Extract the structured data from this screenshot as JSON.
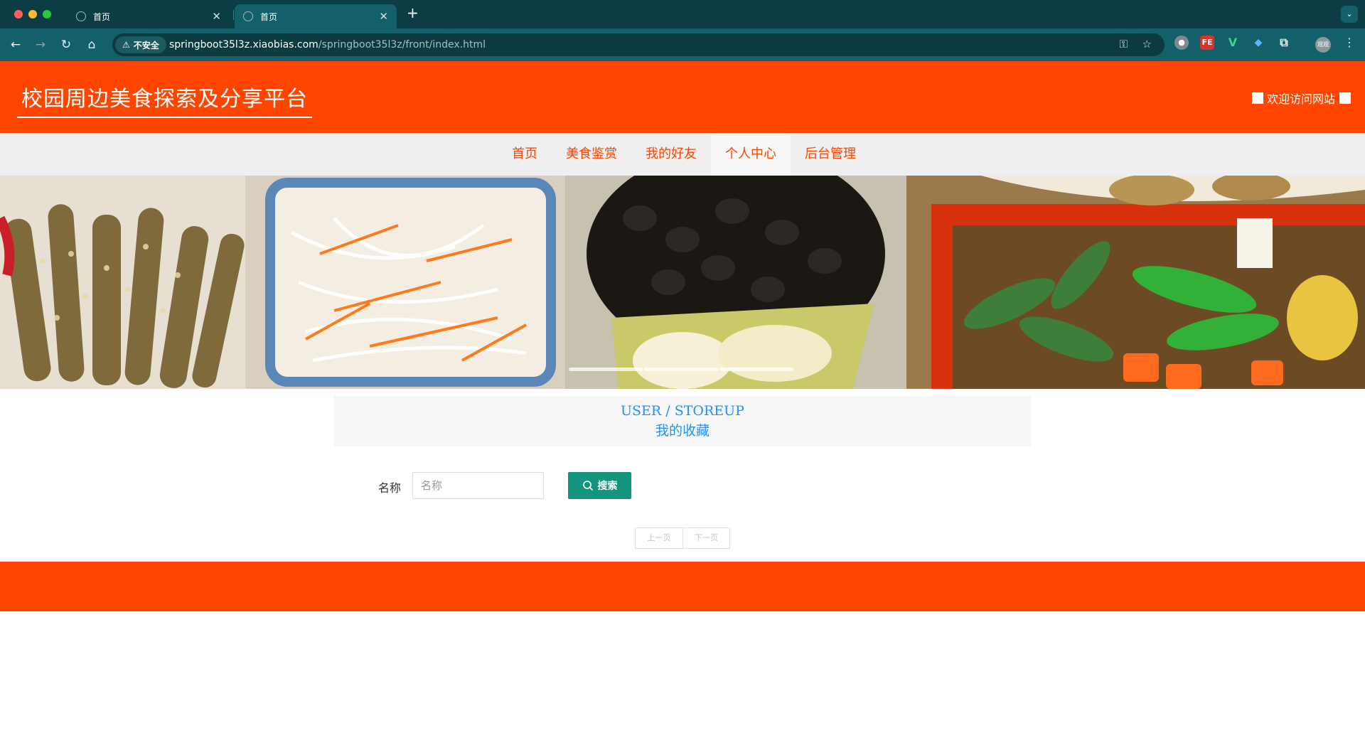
{
  "browser": {
    "tabs": [
      {
        "title": "首页"
      },
      {
        "title": "首页"
      }
    ],
    "new_tab": "+",
    "security_label": "不安全",
    "url_host": "springboot35l3z.xiaobias.com",
    "url_path": "/springboot35l3z/front/index.html",
    "profile_label": "观观"
  },
  "header": {
    "site_title": "校园周边美食探索及分享平台",
    "welcome": "欢迎访问网站"
  },
  "nav": {
    "items": [
      {
        "label": "首页"
      },
      {
        "label": "美食鉴赏"
      },
      {
        "label": "我的好友"
      },
      {
        "label": "个人中心",
        "active": true
      },
      {
        "label": "后台管理"
      }
    ]
  },
  "banner": {
    "slide_count": 3
  },
  "section": {
    "title_en": "USER / STOREUP",
    "title_cn": "我的收藏"
  },
  "search": {
    "label": "名称",
    "placeholder": "名称",
    "value": "",
    "button_label": "搜索"
  },
  "pager": {
    "prev": "上一页",
    "next": "下一页"
  },
  "colors": {
    "brand": "#ff4500",
    "accent_blue": "#1e90ff",
    "button_teal": "#14947e",
    "chrome": "#14606a"
  }
}
